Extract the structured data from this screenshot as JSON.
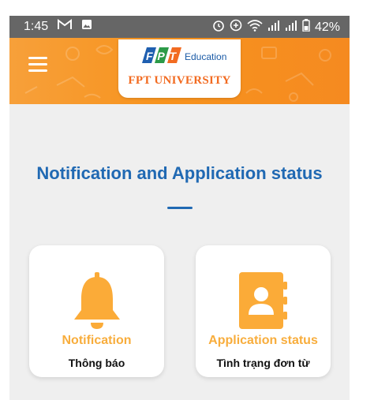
{
  "status_bar": {
    "time": "1:45",
    "battery": "42%"
  },
  "header": {
    "logo_mark": "FPT",
    "education": "Education",
    "university": "FPT UNIVERSITY",
    "menu_icon": "hamburger-menu-icon"
  },
  "main": {
    "title": "Notification and Application status"
  },
  "cards": [
    {
      "label": "Notification",
      "sublabel": "Thông báo",
      "icon": "bell-icon"
    },
    {
      "label": "Application status",
      "sublabel": "Tình trạng đơn từ",
      "icon": "contact-book-icon"
    }
  ],
  "colors": {
    "accent_orange": "#f7931e",
    "title_blue": "#2069b3",
    "card_label_orange": "#f8ad3c",
    "icon_orange": "#fbab38"
  }
}
